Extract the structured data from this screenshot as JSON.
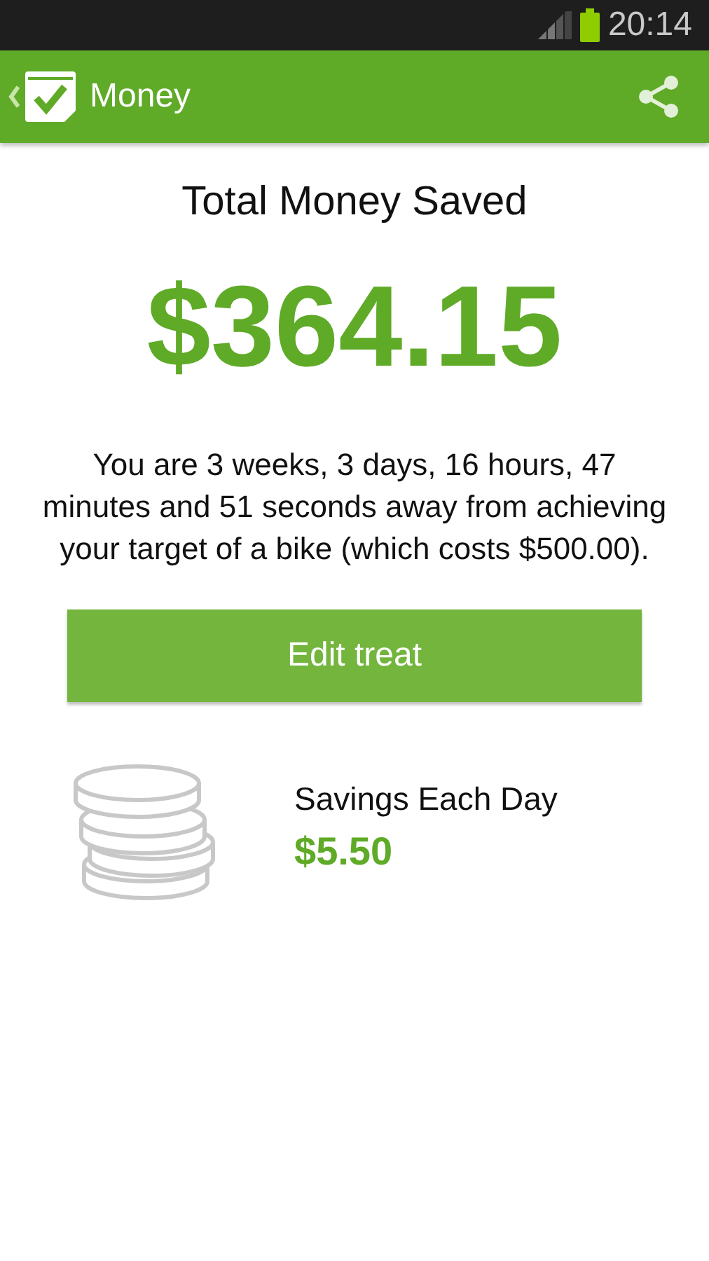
{
  "status_bar": {
    "time": "20:14"
  },
  "app_bar": {
    "title": "Money"
  },
  "heading": "Total Money Saved",
  "amount": "$364.15",
  "message": "You are 3 weeks, 3 days, 16 hours, 47 minutes and 51 seconds away from achieving your target of a bike (which costs $500.00).",
  "button": "Edit treat",
  "savings": {
    "label": "Savings Each Day",
    "value": "$5.50"
  }
}
